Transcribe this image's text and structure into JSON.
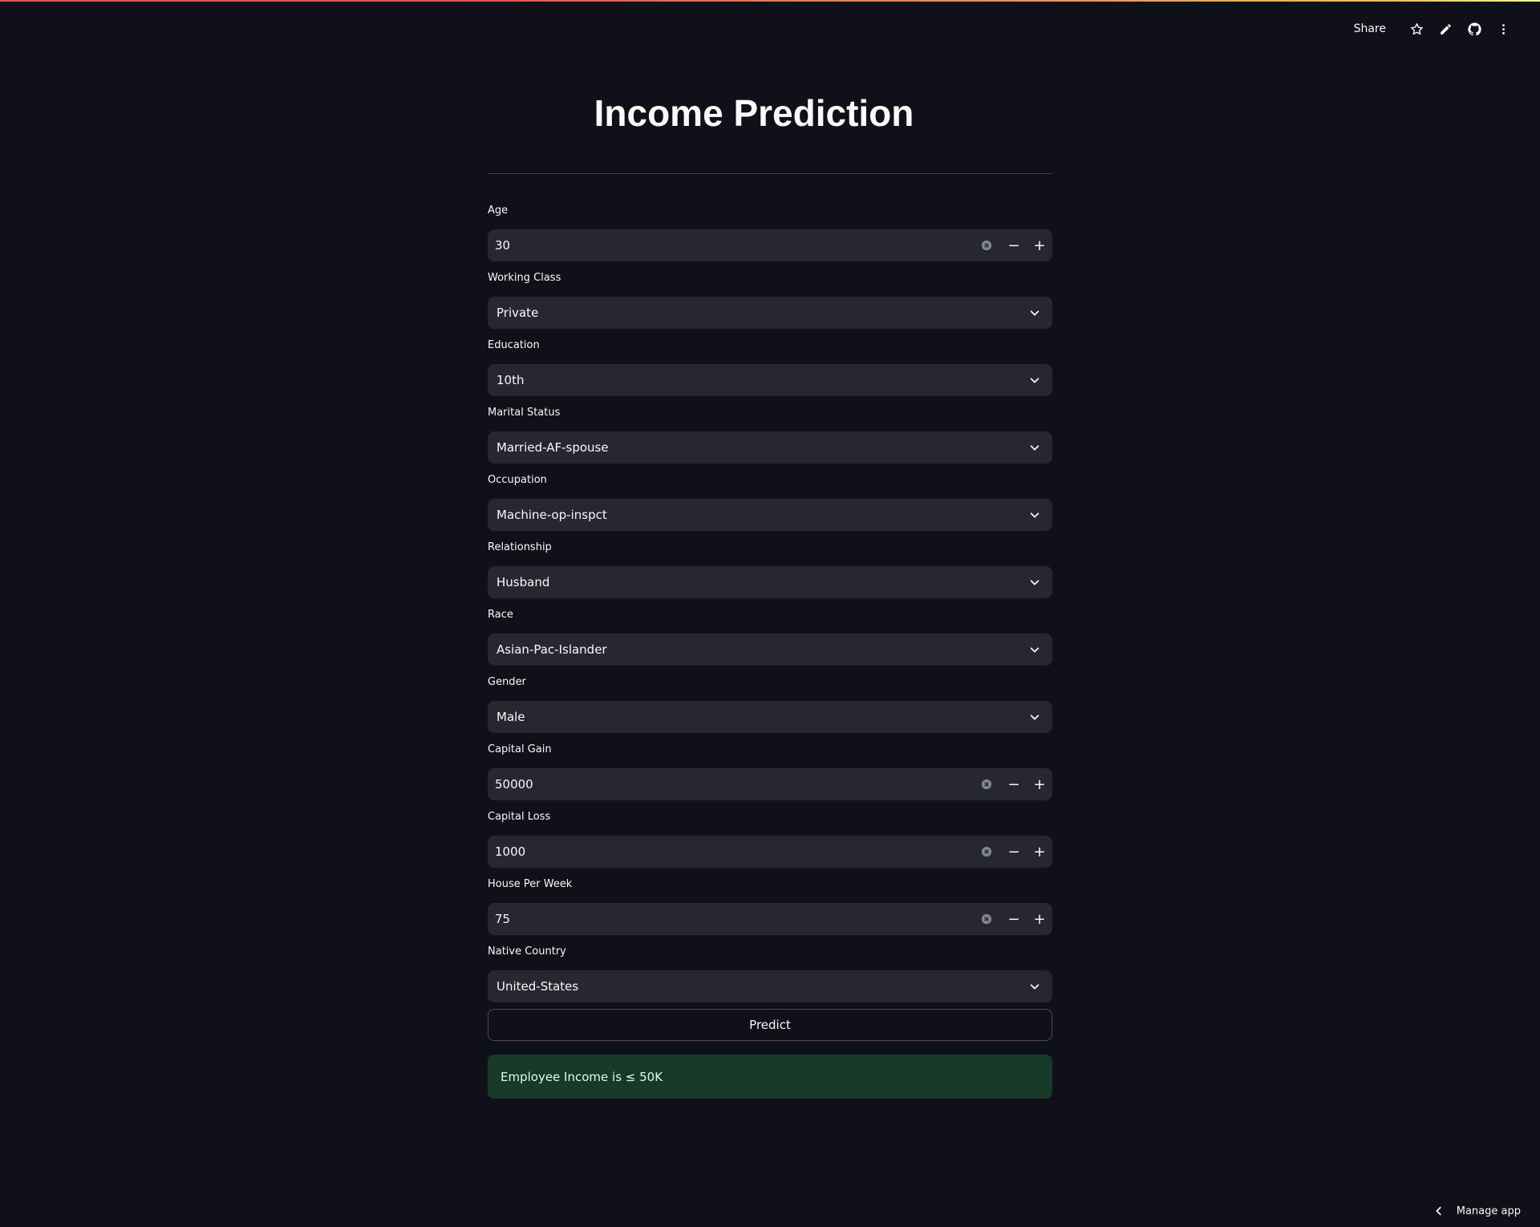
{
  "toolbar": {
    "share_label": "Share",
    "icons": [
      "star-icon",
      "pencil-icon",
      "github-icon",
      "more-vertical-icon"
    ]
  },
  "page": {
    "title": "Income Prediction"
  },
  "form": {
    "age": {
      "label": "Age",
      "value": "30"
    },
    "working_class": {
      "label": "Working Class",
      "value": "Private"
    },
    "education": {
      "label": "Education",
      "value": "10th"
    },
    "marital_status": {
      "label": "Marital Status",
      "value": "Married-AF-spouse"
    },
    "occupation": {
      "label": "Occupation",
      "value": "Machine-op-inspct"
    },
    "relationship": {
      "label": "Relationship",
      "value": "Husband"
    },
    "race": {
      "label": "Race",
      "value": "Asian-Pac-Islander"
    },
    "gender": {
      "label": "Gender",
      "value": "Male"
    },
    "capital_gain": {
      "label": "Capital Gain",
      "value": "50000"
    },
    "capital_loss": {
      "label": "Capital Loss",
      "value": "1000"
    },
    "hours_per_week": {
      "label": "House Per Week",
      "value": "75"
    },
    "native_country": {
      "label": "Native Country",
      "value": "United-States"
    },
    "stepper": {
      "minus": "−",
      "plus": "+"
    },
    "predict_label": "Predict"
  },
  "result": {
    "text": "Employee Income is ≤ 50K"
  },
  "footer": {
    "manage_label": "Manage app"
  },
  "colors": {
    "background": "#0e1117",
    "input_bg": "#262730",
    "success_bg": "#173928",
    "success_text": "#dffde9",
    "accent": "#ff4b4b"
  }
}
